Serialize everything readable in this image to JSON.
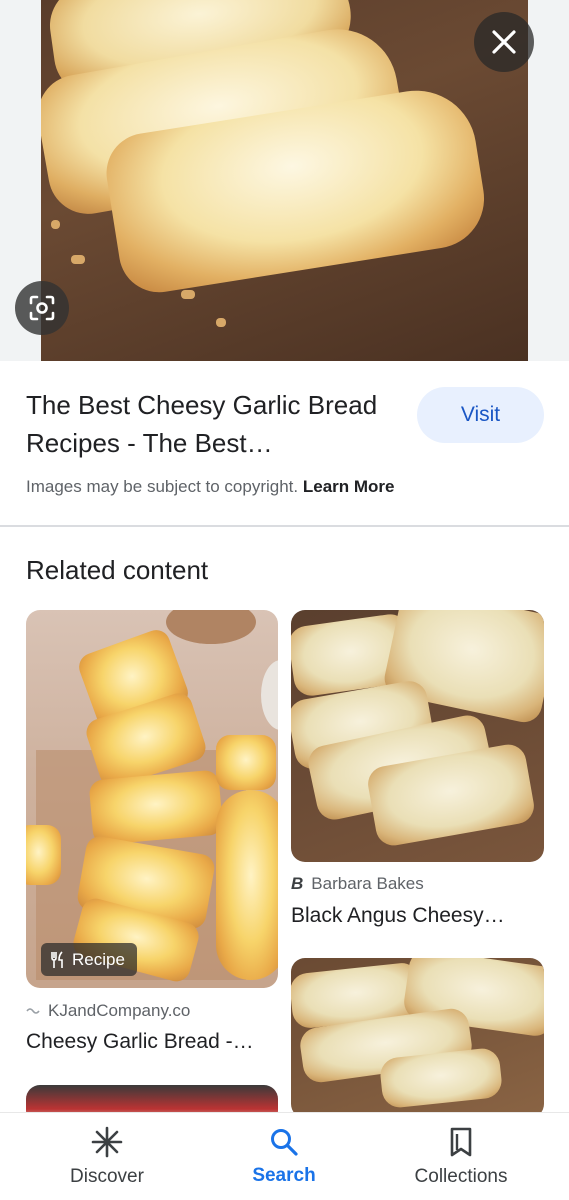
{
  "hero": {
    "close_icon": "close-icon",
    "lens_icon": "lens-icon"
  },
  "result": {
    "title": "The Best Cheesy Garlic Bread Recipes - The Best…",
    "visit_label": "Visit",
    "copyright_text": "Images may be subject to copyright.",
    "learn_more": "Learn More"
  },
  "related": {
    "heading": "Related content",
    "cards": [
      {
        "badge": "Recipe",
        "badge_icon": "fork-knife-icon",
        "source": "KJandCompany.co",
        "title": "Cheesy Garlic Bread -…"
      },
      {
        "source": "Barbara Bakes",
        "source_icon": "barbara-bakes-logo",
        "title": "Black Angus Cheesy…"
      }
    ]
  },
  "nav": {
    "items": [
      {
        "label": "Discover",
        "icon": "asterisk-icon"
      },
      {
        "label": "Search",
        "icon": "search-icon",
        "active": true
      },
      {
        "label": "Collections",
        "icon": "collections-icon"
      }
    ]
  },
  "colors": {
    "accent": "#1a73e8",
    "visit_bg": "#e8f0fe",
    "visit_text": "#1a56c4"
  }
}
